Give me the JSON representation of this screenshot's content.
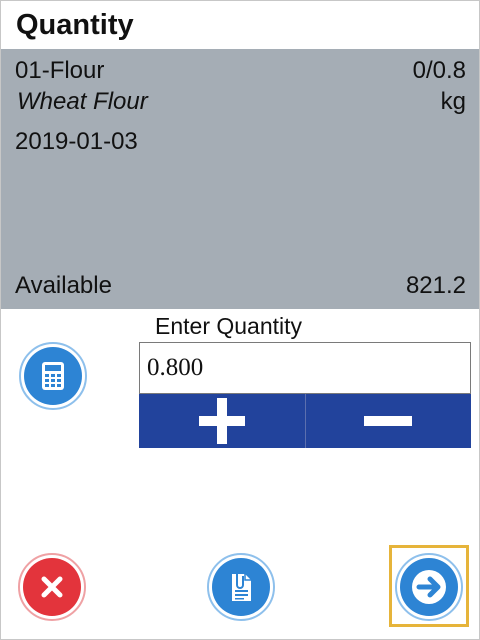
{
  "header": {
    "title": "Quantity"
  },
  "item": {
    "code": "01-Flour",
    "quantity_progress": "0/0.8",
    "description": "Wheat Flour",
    "unit": "kg",
    "date": "2019-01-03"
  },
  "availability": {
    "label": "Available",
    "value": "821.2"
  },
  "entry": {
    "label": "Enter Quantity",
    "value": "0.800"
  },
  "icons": {
    "calculator": "calculator-icon",
    "plus": "plus-icon",
    "minus": "minus-icon",
    "cancel": "close-icon",
    "notes": "document-attachment-icon",
    "next": "arrow-right-icon"
  },
  "colors": {
    "panel_bg": "#a5adb5",
    "stepper_bg": "#22439c",
    "primary_blue": "#2d84d4",
    "cancel_red": "#e3343c",
    "focus_highlight": "#e6b43a"
  }
}
